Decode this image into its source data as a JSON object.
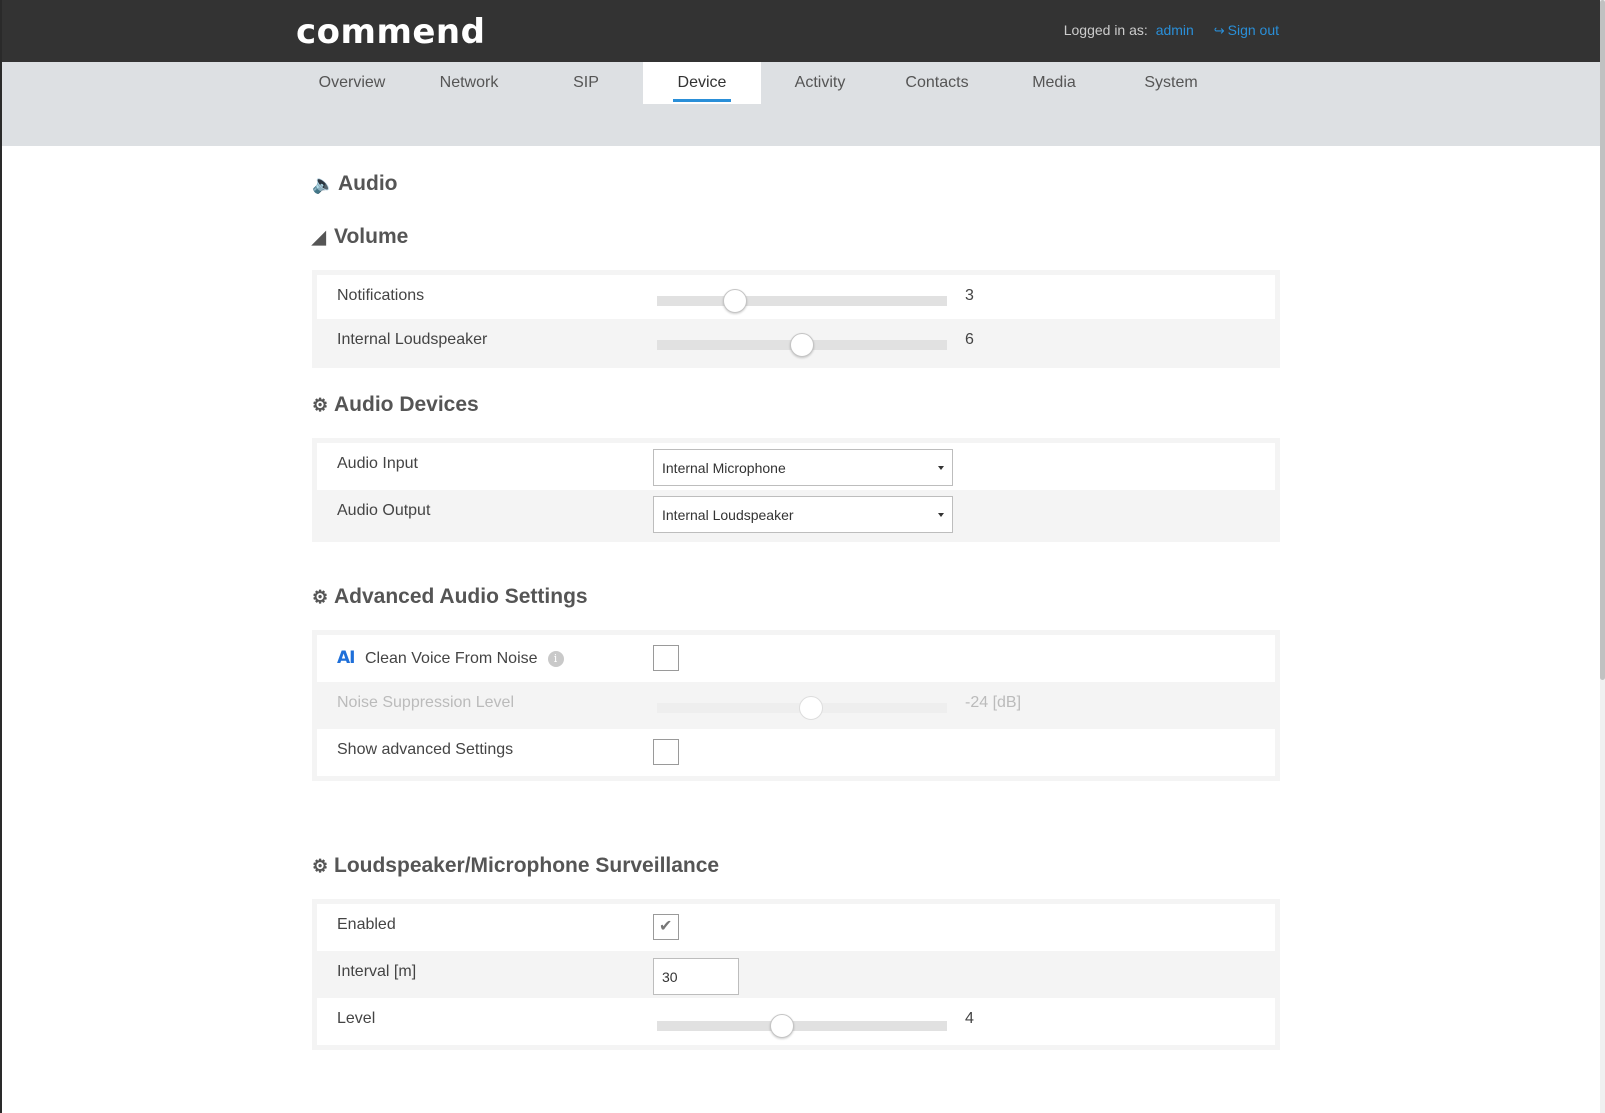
{
  "header": {
    "logo": "commend",
    "logged_in_label": "Logged in as:",
    "user": "admin",
    "sign_out": "Sign out"
  },
  "tabs": [
    {
      "label": "Overview"
    },
    {
      "label": "Network"
    },
    {
      "label": "SIP"
    },
    {
      "label": "Device",
      "active": true
    },
    {
      "label": "Activity"
    },
    {
      "label": "Contacts"
    },
    {
      "label": "Media"
    },
    {
      "label": "System"
    }
  ],
  "audio": {
    "title": "Audio",
    "volume": {
      "title": "Volume",
      "notifications": {
        "label": "Notifications",
        "value": "3",
        "level_fraction": 0.27
      },
      "internal_loudspeaker": {
        "label": "Internal Loudspeaker",
        "value": "6",
        "level_fraction": 0.5
      }
    },
    "devices": {
      "title": "Audio Devices",
      "input": {
        "label": "Audio Input",
        "selected": "Internal Microphone"
      },
      "output": {
        "label": "Audio Output",
        "selected": "Internal Loudspeaker"
      }
    },
    "advanced": {
      "title": "Advanced Audio Settings",
      "ai_badge": "AI",
      "clean_voice": {
        "label": "Clean Voice From Noise",
        "checked": false
      },
      "noise_suppression": {
        "label": "Noise Suppression Level",
        "value": "-24 [dB]",
        "level_fraction": 0.53,
        "disabled": true
      },
      "show_advanced": {
        "label": "Show advanced Settings",
        "checked": false
      }
    },
    "surveillance": {
      "title": "Loudspeaker/Microphone Surveillance",
      "enabled": {
        "label": "Enabled",
        "checked": true
      },
      "interval": {
        "label": "Interval [m]",
        "value": "30"
      },
      "level": {
        "label": "Level",
        "value": "4",
        "level_fraction": 0.43
      }
    }
  },
  "colors": {
    "topbar": "#333333",
    "navbar": "#dde0e3",
    "accent": "#2a8fd8",
    "panel": "#f4f4f4"
  }
}
